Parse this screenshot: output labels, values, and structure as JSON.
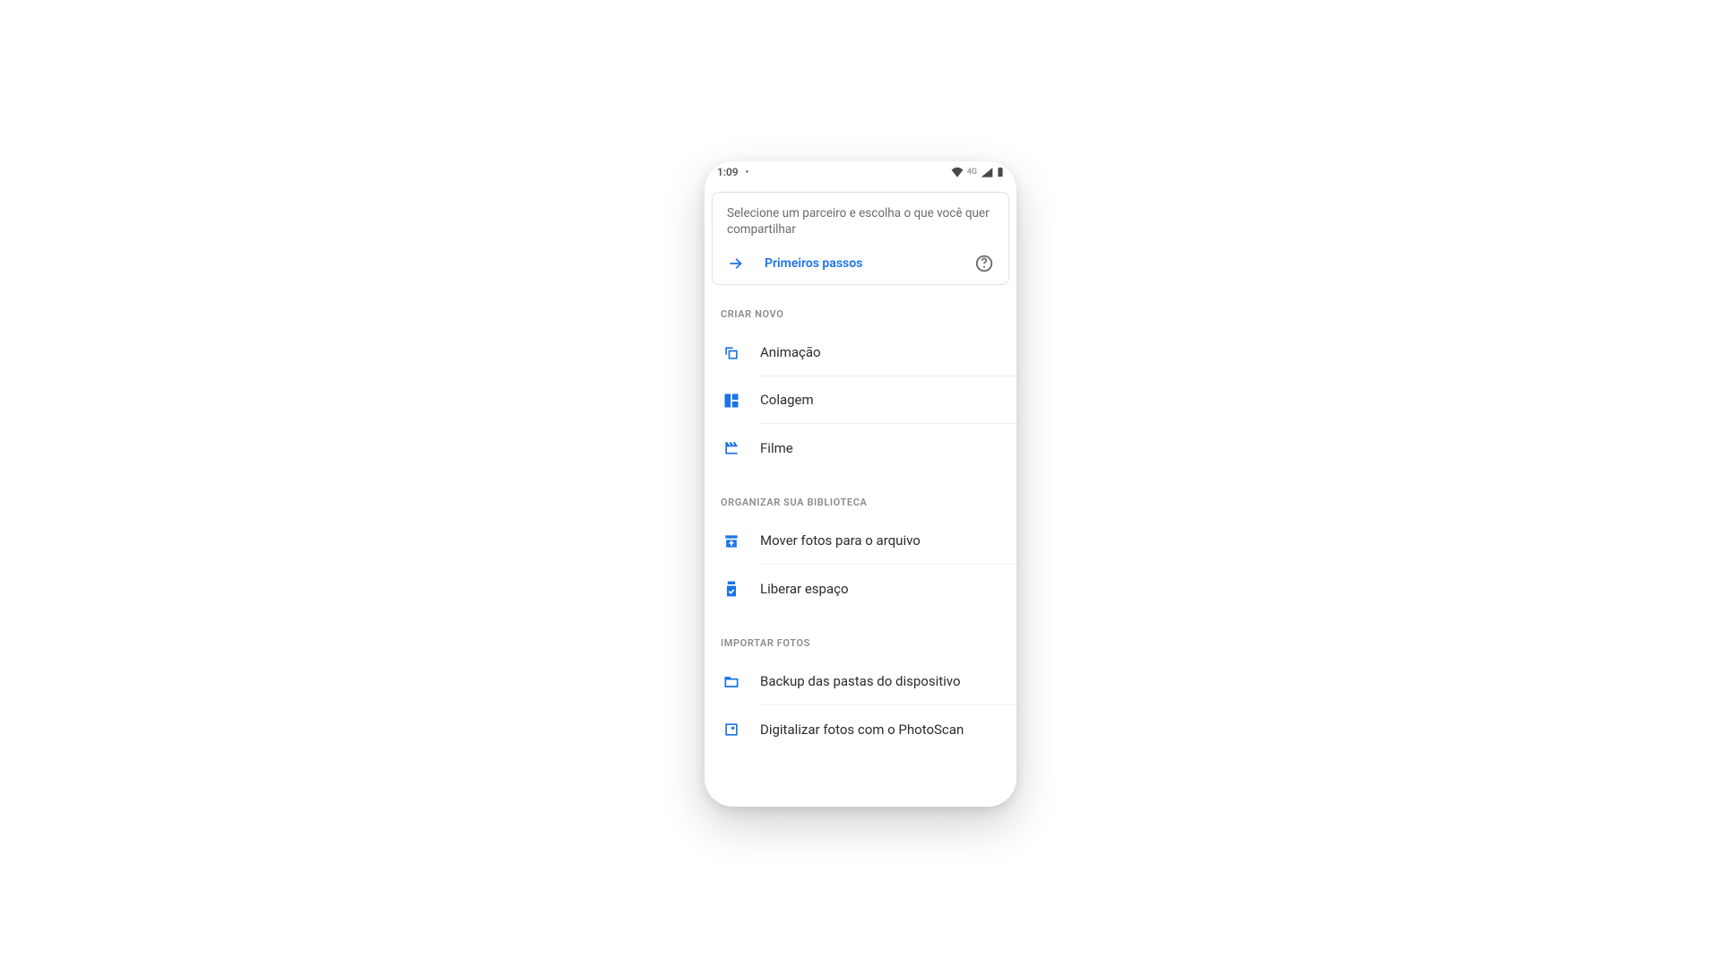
{
  "statusbar": {
    "time": "1:09",
    "network": "4G"
  },
  "card": {
    "description": "Selecione um parceiro e escolha o que você quer compartilhar",
    "action": "Primeiros passos"
  },
  "sections": {
    "create": {
      "header": "Criar novo",
      "items": [
        "Animação",
        "Colagem",
        "Filme"
      ]
    },
    "organize": {
      "header": "Organizar sua biblioteca",
      "items": [
        "Mover fotos para o arquivo",
        "Liberar espaço"
      ]
    },
    "import": {
      "header": "Importar fotos",
      "items": [
        "Backup das pastas do dispositivo",
        "Digitalizar fotos com o PhotoScan"
      ]
    }
  }
}
